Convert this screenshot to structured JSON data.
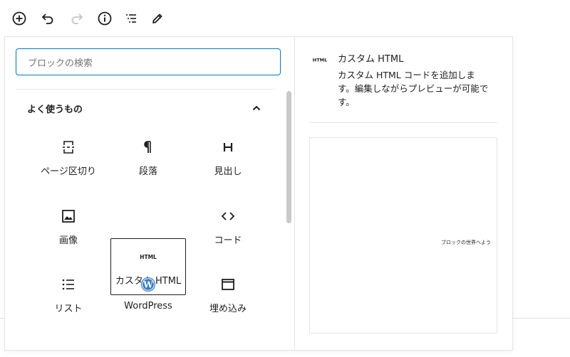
{
  "toolbar": {
    "buttons": [
      {
        "icon": "add-block-icon"
      },
      {
        "icon": "undo-icon"
      },
      {
        "icon": "redo-icon"
      },
      {
        "icon": "info-icon"
      },
      {
        "icon": "list-view-icon"
      },
      {
        "icon": "edit-pencil-icon"
      }
    ]
  },
  "inserter": {
    "search": {
      "placeholder": "ブロックの検索"
    },
    "category": {
      "title": "よく使うもの",
      "expanded": true
    },
    "blocks": [
      {
        "label": "ページ区切り",
        "icon": "page-break-icon"
      },
      {
        "label": "段落",
        "icon": "paragraph-icon"
      },
      {
        "label": "見出し",
        "icon": "heading-icon"
      },
      {
        "label": "画像",
        "icon": "image-icon"
      },
      {
        "label": "カスタム HTML",
        "icon": "html-icon",
        "selected": true
      },
      {
        "label": "コード",
        "icon": "code-icon"
      },
      {
        "label": "リスト",
        "icon": "list-icon"
      },
      {
        "label": "WordPress",
        "icon": "wordpress-icon"
      },
      {
        "label": "埋め込み",
        "icon": "embed-icon"
      }
    ]
  },
  "preview": {
    "icon_text": "HTML",
    "title": "カスタム HTML",
    "description": "カスタム HTML コードを追加しま\nす。編集しながらプレビューが可能で\nす。",
    "sample_text": "ブロックの世界へよう"
  },
  "colors": {
    "accent": "#007cba",
    "text": "#1e1e1e",
    "border": "#e2e4e7",
    "wordpress_blue": "#3a7bbf"
  }
}
